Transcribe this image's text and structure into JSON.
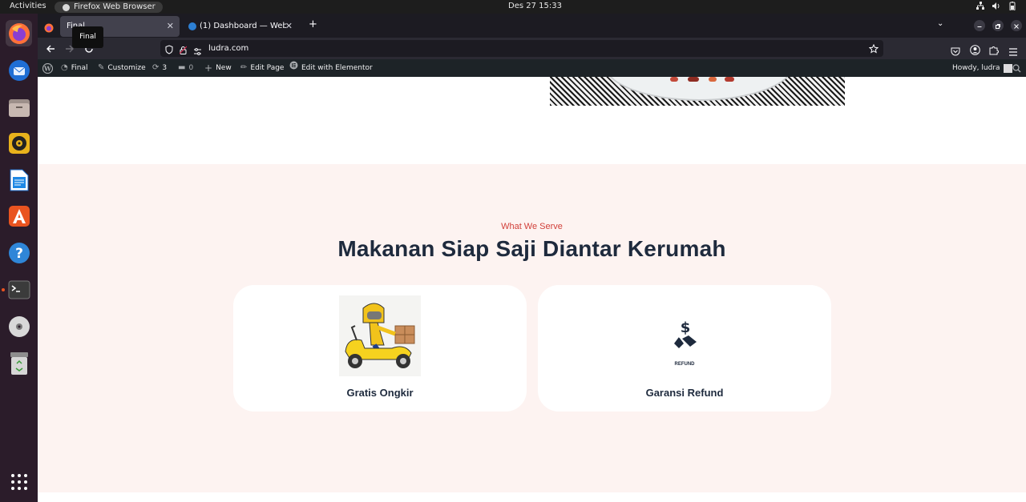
{
  "system_bar": {
    "activities_label": "Activities",
    "app_label": "Firefox Web Browser",
    "clock": "Des 27  15:33"
  },
  "browser": {
    "tabs": [
      {
        "title": "Final",
        "active": true
      },
      {
        "title": "(1) Dashboard — Webmi",
        "active": false
      }
    ],
    "tooltip": "Final",
    "url": "ludra.com"
  },
  "wp_admin_bar": {
    "site_name": "Final",
    "customize": "Customize",
    "updates_count": "3",
    "comments_count": "0",
    "new_label": "New",
    "edit_page": "Edit Page",
    "edit_elementor": "Edit with Elementor",
    "howdy": "Howdy, ludra"
  },
  "section": {
    "kicker": "What We Serve",
    "heading": "Makanan Siap Saji Diantar Kerumah",
    "cards": [
      {
        "title": "Gratis Ongkir",
        "icon": "delivery-scooter-illustration"
      },
      {
        "title": "Garansi Refund",
        "icon": "refund-dollar-icon",
        "caption": "REFUND"
      }
    ]
  },
  "colors": {
    "accent": "#d1403a",
    "heading": "#1e2a3d",
    "section_bg": "#fdf3f1",
    "wp_bar": "#1d2327",
    "dock": "#2b1c2a"
  }
}
